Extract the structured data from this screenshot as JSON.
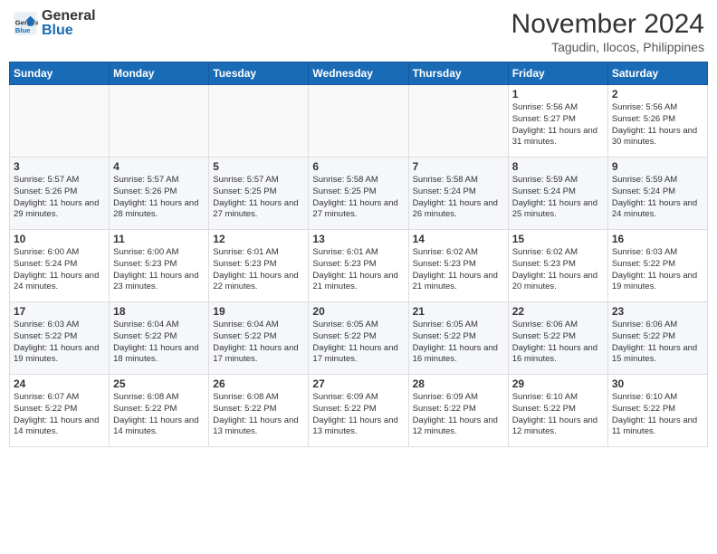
{
  "header": {
    "logo_general": "General",
    "logo_blue": "Blue",
    "month_year": "November 2024",
    "location": "Tagudin, Ilocos, Philippines"
  },
  "weekdays": [
    "Sunday",
    "Monday",
    "Tuesday",
    "Wednesday",
    "Thursday",
    "Friday",
    "Saturday"
  ],
  "weeks": [
    [
      {
        "day": "",
        "sunrise": "",
        "sunset": "",
        "daylight": ""
      },
      {
        "day": "",
        "sunrise": "",
        "sunset": "",
        "daylight": ""
      },
      {
        "day": "",
        "sunrise": "",
        "sunset": "",
        "daylight": ""
      },
      {
        "day": "",
        "sunrise": "",
        "sunset": "",
        "daylight": ""
      },
      {
        "day": "",
        "sunrise": "",
        "sunset": "",
        "daylight": ""
      },
      {
        "day": "1",
        "sunrise": "Sunrise: 5:56 AM",
        "sunset": "Sunset: 5:27 PM",
        "daylight": "Daylight: 11 hours and 31 minutes."
      },
      {
        "day": "2",
        "sunrise": "Sunrise: 5:56 AM",
        "sunset": "Sunset: 5:26 PM",
        "daylight": "Daylight: 11 hours and 30 minutes."
      }
    ],
    [
      {
        "day": "3",
        "sunrise": "Sunrise: 5:57 AM",
        "sunset": "Sunset: 5:26 PM",
        "daylight": "Daylight: 11 hours and 29 minutes."
      },
      {
        "day": "4",
        "sunrise": "Sunrise: 5:57 AM",
        "sunset": "Sunset: 5:26 PM",
        "daylight": "Daylight: 11 hours and 28 minutes."
      },
      {
        "day": "5",
        "sunrise": "Sunrise: 5:57 AM",
        "sunset": "Sunset: 5:25 PM",
        "daylight": "Daylight: 11 hours and 27 minutes."
      },
      {
        "day": "6",
        "sunrise": "Sunrise: 5:58 AM",
        "sunset": "Sunset: 5:25 PM",
        "daylight": "Daylight: 11 hours and 27 minutes."
      },
      {
        "day": "7",
        "sunrise": "Sunrise: 5:58 AM",
        "sunset": "Sunset: 5:24 PM",
        "daylight": "Daylight: 11 hours and 26 minutes."
      },
      {
        "day": "8",
        "sunrise": "Sunrise: 5:59 AM",
        "sunset": "Sunset: 5:24 PM",
        "daylight": "Daylight: 11 hours and 25 minutes."
      },
      {
        "day": "9",
        "sunrise": "Sunrise: 5:59 AM",
        "sunset": "Sunset: 5:24 PM",
        "daylight": "Daylight: 11 hours and 24 minutes."
      }
    ],
    [
      {
        "day": "10",
        "sunrise": "Sunrise: 6:00 AM",
        "sunset": "Sunset: 5:24 PM",
        "daylight": "Daylight: 11 hours and 24 minutes."
      },
      {
        "day": "11",
        "sunrise": "Sunrise: 6:00 AM",
        "sunset": "Sunset: 5:23 PM",
        "daylight": "Daylight: 11 hours and 23 minutes."
      },
      {
        "day": "12",
        "sunrise": "Sunrise: 6:01 AM",
        "sunset": "Sunset: 5:23 PM",
        "daylight": "Daylight: 11 hours and 22 minutes."
      },
      {
        "day": "13",
        "sunrise": "Sunrise: 6:01 AM",
        "sunset": "Sunset: 5:23 PM",
        "daylight": "Daylight: 11 hours and 21 minutes."
      },
      {
        "day": "14",
        "sunrise": "Sunrise: 6:02 AM",
        "sunset": "Sunset: 5:23 PM",
        "daylight": "Daylight: 11 hours and 21 minutes."
      },
      {
        "day": "15",
        "sunrise": "Sunrise: 6:02 AM",
        "sunset": "Sunset: 5:23 PM",
        "daylight": "Daylight: 11 hours and 20 minutes."
      },
      {
        "day": "16",
        "sunrise": "Sunrise: 6:03 AM",
        "sunset": "Sunset: 5:22 PM",
        "daylight": "Daylight: 11 hours and 19 minutes."
      }
    ],
    [
      {
        "day": "17",
        "sunrise": "Sunrise: 6:03 AM",
        "sunset": "Sunset: 5:22 PM",
        "daylight": "Daylight: 11 hours and 19 minutes."
      },
      {
        "day": "18",
        "sunrise": "Sunrise: 6:04 AM",
        "sunset": "Sunset: 5:22 PM",
        "daylight": "Daylight: 11 hours and 18 minutes."
      },
      {
        "day": "19",
        "sunrise": "Sunrise: 6:04 AM",
        "sunset": "Sunset: 5:22 PM",
        "daylight": "Daylight: 11 hours and 17 minutes."
      },
      {
        "day": "20",
        "sunrise": "Sunrise: 6:05 AM",
        "sunset": "Sunset: 5:22 PM",
        "daylight": "Daylight: 11 hours and 17 minutes."
      },
      {
        "day": "21",
        "sunrise": "Sunrise: 6:05 AM",
        "sunset": "Sunset: 5:22 PM",
        "daylight": "Daylight: 11 hours and 16 minutes."
      },
      {
        "day": "22",
        "sunrise": "Sunrise: 6:06 AM",
        "sunset": "Sunset: 5:22 PM",
        "daylight": "Daylight: 11 hours and 16 minutes."
      },
      {
        "day": "23",
        "sunrise": "Sunrise: 6:06 AM",
        "sunset": "Sunset: 5:22 PM",
        "daylight": "Daylight: 11 hours and 15 minutes."
      }
    ],
    [
      {
        "day": "24",
        "sunrise": "Sunrise: 6:07 AM",
        "sunset": "Sunset: 5:22 PM",
        "daylight": "Daylight: 11 hours and 14 minutes."
      },
      {
        "day": "25",
        "sunrise": "Sunrise: 6:08 AM",
        "sunset": "Sunset: 5:22 PM",
        "daylight": "Daylight: 11 hours and 14 minutes."
      },
      {
        "day": "26",
        "sunrise": "Sunrise: 6:08 AM",
        "sunset": "Sunset: 5:22 PM",
        "daylight": "Daylight: 11 hours and 13 minutes."
      },
      {
        "day": "27",
        "sunrise": "Sunrise: 6:09 AM",
        "sunset": "Sunset: 5:22 PM",
        "daylight": "Daylight: 11 hours and 13 minutes."
      },
      {
        "day": "28",
        "sunrise": "Sunrise: 6:09 AM",
        "sunset": "Sunset: 5:22 PM",
        "daylight": "Daylight: 11 hours and 12 minutes."
      },
      {
        "day": "29",
        "sunrise": "Sunrise: 6:10 AM",
        "sunset": "Sunset: 5:22 PM",
        "daylight": "Daylight: 11 hours and 12 minutes."
      },
      {
        "day": "30",
        "sunrise": "Sunrise: 6:10 AM",
        "sunset": "Sunset: 5:22 PM",
        "daylight": "Daylight: 11 hours and 11 minutes."
      }
    ]
  ]
}
